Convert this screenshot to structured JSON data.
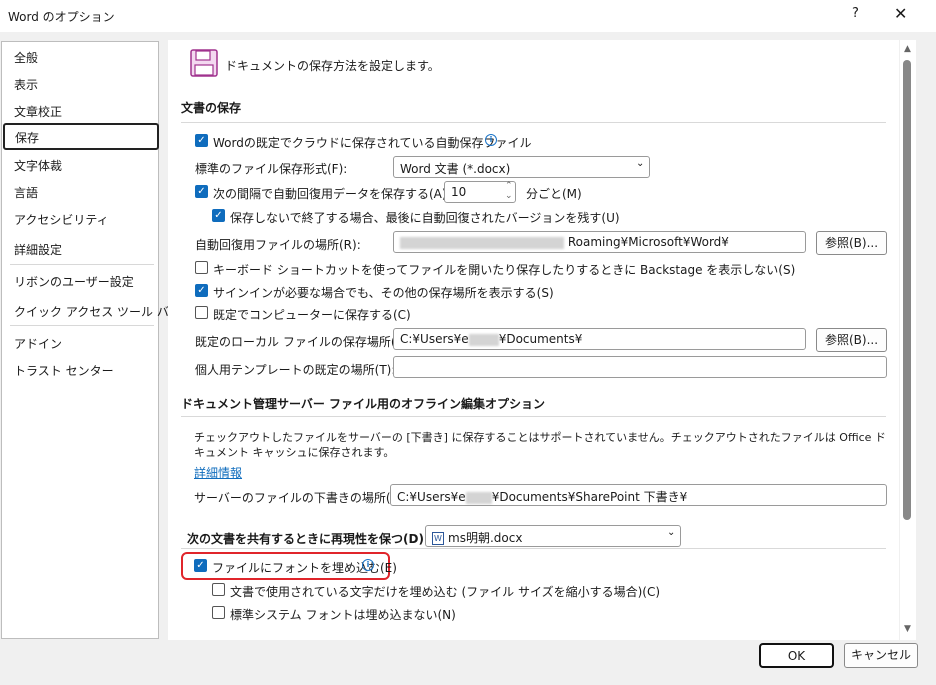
{
  "window": {
    "title": "Word のオプション",
    "help_label": "?",
    "close_label": "✕"
  },
  "sidebar": {
    "items": [
      {
        "label": "全般"
      },
      {
        "label": "表示"
      },
      {
        "label": "文章校正"
      },
      {
        "label": "保存"
      },
      {
        "label": "文字体裁"
      },
      {
        "label": "言語"
      },
      {
        "label": "アクセシビリティ"
      },
      {
        "label": "詳細設定"
      },
      {
        "label": "リボンのユーザー設定"
      },
      {
        "label": "クイック アクセス ツール バー"
      },
      {
        "label": "アドイン"
      },
      {
        "label": "トラスト センター"
      }
    ],
    "selected": "保存"
  },
  "page": {
    "intro": "ドキュメントの保存方法を設定します。",
    "intro_icon": "save-icon",
    "section_save": "文書の保存",
    "autosave_cloud": {
      "label": "Wordの既定でクラウドに保存されている自動保存ファイル",
      "checked": true
    },
    "default_format": {
      "label": "標準のファイル保存形式(F):",
      "value": "Word 文書 (*.docx)"
    },
    "autorecover": {
      "label": "次の間隔で自動回復用データを保存する(A):",
      "checked": true,
      "value": "10",
      "unit": "分ごと(M)"
    },
    "keep_last": {
      "label": "保存しないで終了する場合、最後に自動回復されたバージョンを残す(U)",
      "checked": true
    },
    "autorecover_location": {
      "label": "自動回復用ファイルの場所(R):",
      "value": "Roaming¥Microsoft¥Word¥",
      "browse": "参照(B)..."
    },
    "backstage": {
      "label": "キーボード ショートカットを使ってファイルを開いたり保存したりするときに Backstage を表示しない(S)",
      "checked": false
    },
    "show_locations": {
      "label": "サインインが必要な場合でも、その他の保存場所を表示する(S)",
      "checked": true
    },
    "save_to_computer": {
      "label": "既定でコンピューターに保存する(C)",
      "checked": false
    },
    "local_location": {
      "label": "既定のローカル ファイルの保存場所(I):",
      "value_prefix": "C:¥Users¥e",
      "value_suffix": "¥Documents¥",
      "browse": "参照(B)..."
    },
    "template_location": {
      "label": "個人用テンプレートの既定の場所(T):",
      "value": ""
    },
    "section_offline": "ドキュメント管理サーバー ファイル用のオフライン編集オプション",
    "offline_notice": "チェックアウトしたファイルをサーバーの [下書き] に保存することはサポートされていません。チェックアウトされたファイルは Office ドキュメント キャッシュに保存されます。",
    "more_info": "詳細情報",
    "drafts_location": {
      "label": "サーバーのファイルの下書きの場所(V):",
      "value_prefix": "C:¥Users¥e",
      "value_suffix": "¥Documents¥SharePoint 下書き¥"
    },
    "fidelity": {
      "label": "次の文書を共有するときに再現性を保つ(D):",
      "doc": "ms明朝.docx"
    },
    "embed_fonts": {
      "label": "ファイルにフォントを埋め込む(E)",
      "checked": true
    },
    "embed_used_only": {
      "label": "文書で使用されている文字だけを埋め込む (ファイル サイズを縮小する場合)(C)",
      "checked": false
    },
    "no_system_fonts": {
      "label": "標準システム フォントは埋め込まない(N)",
      "checked": false
    }
  },
  "footer": {
    "ok": "OK",
    "cancel": "キャンセル"
  },
  "colors": {
    "accent": "#0f6cbd",
    "highlight": "#e0252b"
  }
}
